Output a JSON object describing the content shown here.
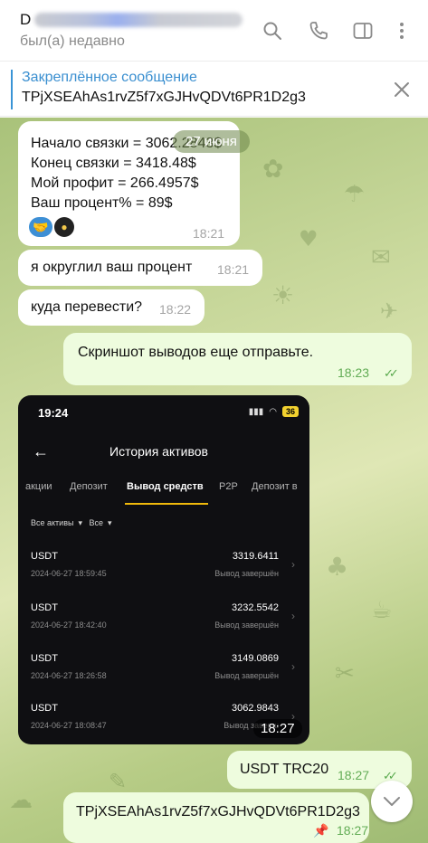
{
  "header": {
    "name_initial": "D",
    "status": "был(а) недавно"
  },
  "pinned": {
    "title": "Закреплённое сообщение",
    "text": "TPjXSEAhAs1rvZ5f7xGJHvQDVt6PR1D2g3"
  },
  "date_pill": "27 июня",
  "messages": [
    {
      "lines": [
        "Начало связки = 3062.2843$",
        "Конец связки = 3418.48$",
        "Мой профит = 266.4957$",
        "Ваш процент% = 89$"
      ],
      "time": "18:21"
    },
    {
      "text": "я округлил ваш процент",
      "time": "18:21"
    },
    {
      "text": "куда перевести?",
      "time": "18:22"
    },
    {
      "text": "Скриншот выводов еще отправьте.",
      "time": "18:23"
    },
    {
      "text": "USDT TRC20",
      "time": "18:27"
    },
    {
      "text": "TPjXSEAhAs1rvZ5f7xGJHvQDVt6PR1D2g3",
      "time": "18:27"
    }
  ],
  "screenshot": {
    "clock": "19:24",
    "battery": "36",
    "title": "История активов",
    "tabs": [
      "акции",
      "Депозит",
      "Вывод средств",
      "P2P",
      "Депозит в"
    ],
    "filters": [
      "Все активы",
      "Все"
    ],
    "rows": [
      {
        "coin": "USDT",
        "amount": "3319.6411",
        "date": "2024-06-27 18:59:45",
        "status": "Вывод завершён"
      },
      {
        "coin": "USDT",
        "amount": "3232.5542",
        "date": "2024-06-27 18:42:40",
        "status": "Вывод завершён"
      },
      {
        "coin": "USDT",
        "amount": "3149.0869",
        "date": "2024-06-27 18:26:58",
        "status": "Вывод завершён"
      },
      {
        "coin": "USDT",
        "amount": "3062.9843",
        "date": "2024-06-27 18:08:47",
        "status": "Вывод заверш"
      }
    ],
    "time": "18:27"
  },
  "colors": {
    "accent": "#3a8fd0",
    "outgoing_bubble": "#eefcde",
    "check": "#58a84c",
    "tab_underline": "#f0b90b"
  }
}
